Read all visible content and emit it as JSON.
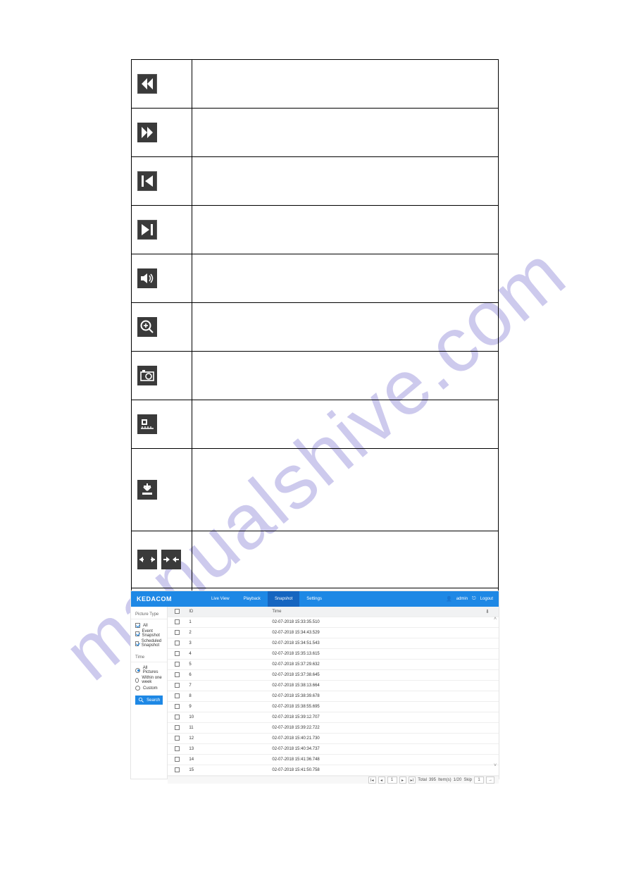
{
  "watermark": "manualshive.com",
  "toolbar_icons": {
    "rewind": {
      "name": "rewind-icon"
    },
    "fast_forward": {
      "name": "fast-forward-icon"
    },
    "prev_frame": {
      "name": "previous-frame-icon"
    },
    "next_frame": {
      "name": "next-frame-icon"
    },
    "volume": {
      "name": "volume-icon"
    },
    "zoom": {
      "name": "zoom-icon"
    },
    "snapshot": {
      "name": "snapshot-camera-icon"
    },
    "ruler_h": {
      "name": "timeline-ruler-icon"
    },
    "download": {
      "name": "download-icon"
    },
    "stretch": {
      "name": "zoom-out-timeline-icon"
    },
    "squeeze": {
      "name": "zoom-in-timeline-icon"
    },
    "fullscreen": {
      "name": "fullscreen-icon"
    }
  },
  "app": {
    "brand": "KEDACOM",
    "nav": {
      "live_view": "Live View",
      "playback": "Playback",
      "snapshot": "Snapshot",
      "settings": "Settings"
    },
    "user": {
      "name": "admin",
      "logout": "Logout"
    },
    "sidebar": {
      "picture_type_label": "Picture Type",
      "all_label": "All",
      "event_snapshot_label": "Event Snapshot",
      "scheduled_snapshot_label": "Scheduled Snapshot",
      "time_label": "Time",
      "all_pictures_label": "All Pictures",
      "within_one_week_label": "Within one week",
      "custom_label": "Custom",
      "search_label": "Search"
    },
    "table": {
      "headers": {
        "id": "ID",
        "time": "Time"
      },
      "rows": [
        {
          "id": "1",
          "time": "02-07-2018 15:33:35.510"
        },
        {
          "id": "2",
          "time": "02-07-2018 15:34:43.529"
        },
        {
          "id": "3",
          "time": "02-07-2018 15:34:51.543"
        },
        {
          "id": "4",
          "time": "02-07-2018 15:35:13.615"
        },
        {
          "id": "5",
          "time": "02-07-2018 15:37:29.632"
        },
        {
          "id": "6",
          "time": "02-07-2018 15:37:38.645"
        },
        {
          "id": "7",
          "time": "02-07-2018 15:38:13.664"
        },
        {
          "id": "8",
          "time": "02-07-2018 15:38:39.678"
        },
        {
          "id": "9",
          "time": "02-07-2018 15:38:55.695"
        },
        {
          "id": "10",
          "time": "02-07-2018 15:39:12.707"
        },
        {
          "id": "11",
          "time": "02-07-2018 15:39:22.722"
        },
        {
          "id": "12",
          "time": "02-07-2018 15:40:21.730"
        },
        {
          "id": "13",
          "time": "02-07-2018 15:40:34.737"
        },
        {
          "id": "14",
          "time": "02-07-2018 15:41:36.748"
        },
        {
          "id": "15",
          "time": "02-07-2018 15:41:50.758"
        }
      ]
    },
    "pager": {
      "first": "I◂",
      "prev": "◂",
      "page_value": "1",
      "next": "▸",
      "last": "▸I",
      "total_label": "Total",
      "total_count": "395",
      "items_label": "Item(s)",
      "pages_label": "1/20",
      "skip_label": "Skip",
      "skip_value": "1",
      "go": "→"
    }
  }
}
